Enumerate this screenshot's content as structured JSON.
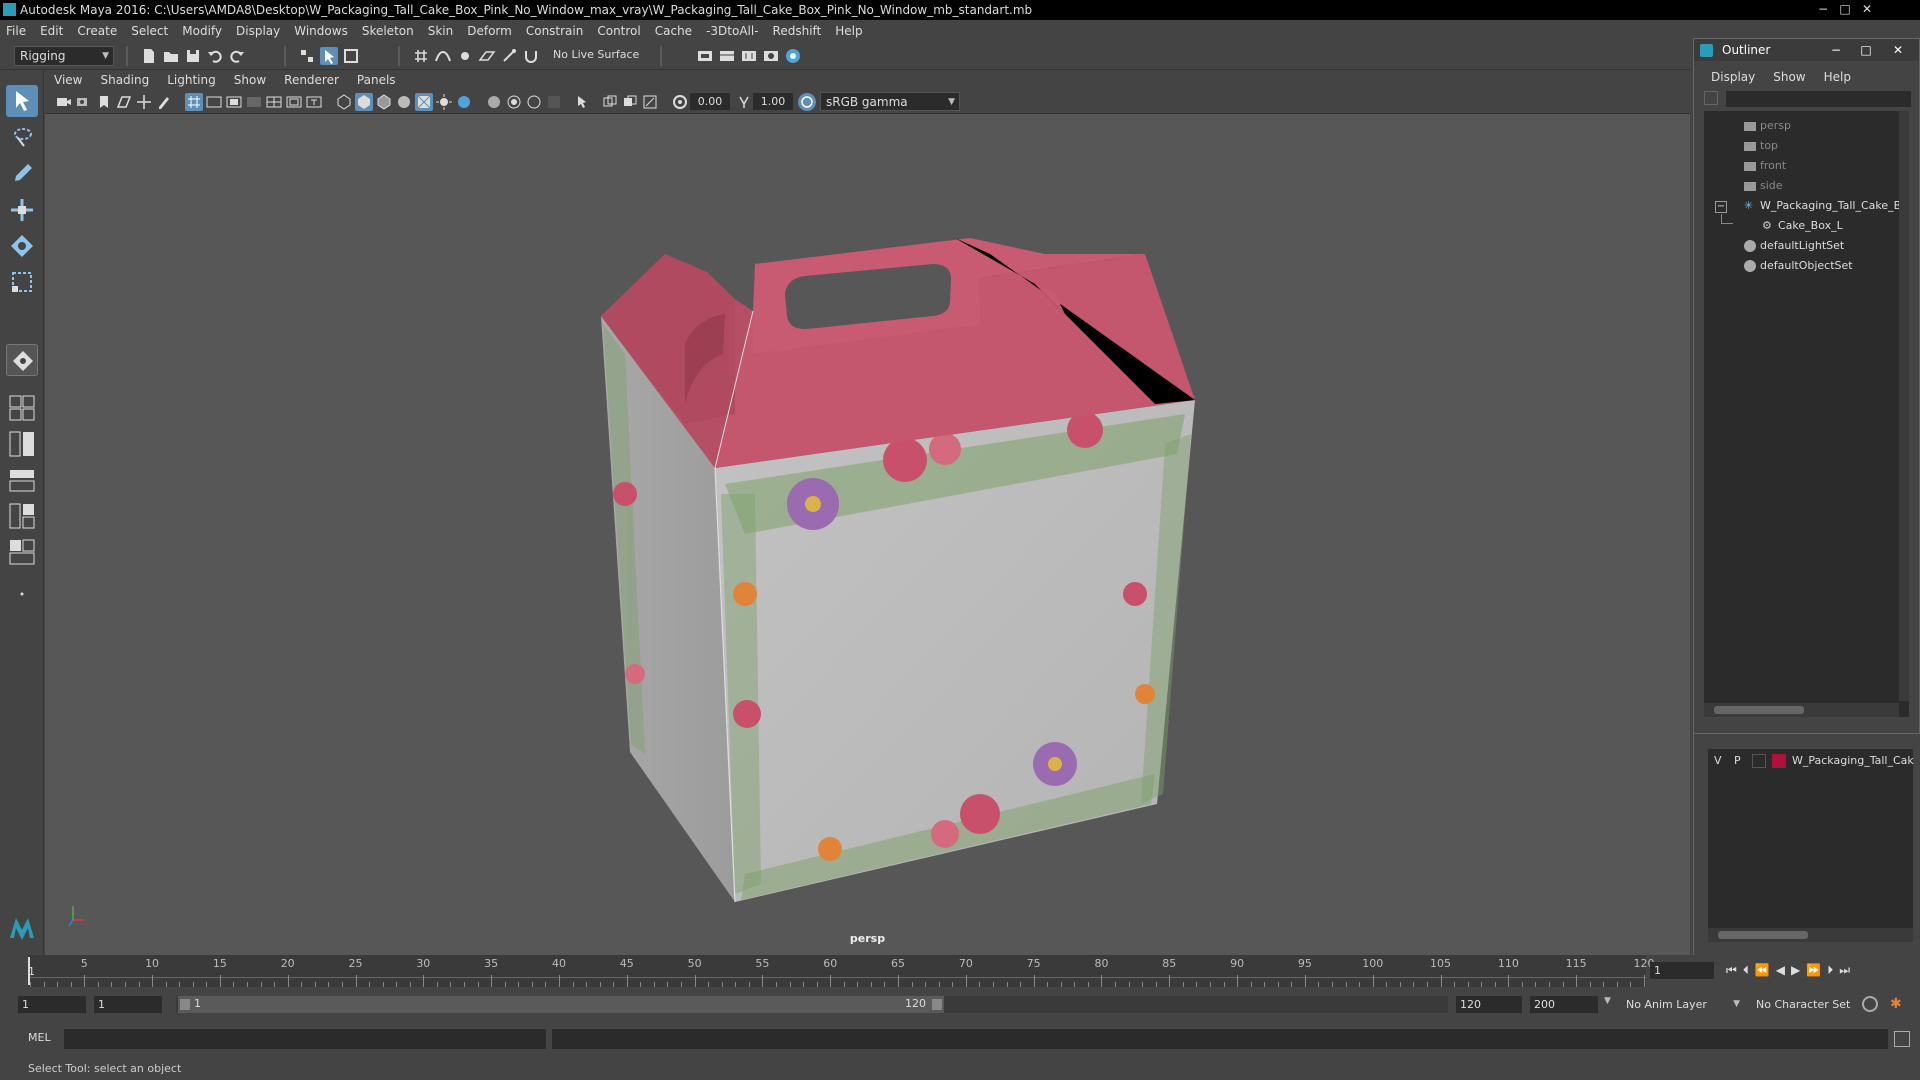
{
  "window": {
    "title": "Autodesk Maya 2016: C:\\Users\\AMDA8\\Desktop\\W_Packaging_Tall_Cake_Box_Pink_No_Window_max_vray\\W_Packaging_Tall_Cake_Box_Pink_No_Window_mb_standart.mb",
    "minimize": "−",
    "maximize": "□",
    "close": "✕"
  },
  "menubar": {
    "items": [
      "File",
      "Edit",
      "Create",
      "Select",
      "Modify",
      "Display",
      "Windows",
      "Skeleton",
      "Skin",
      "Deform",
      "Constrain",
      "Control",
      "Cache",
      "-3DtoAll-",
      "Redshift",
      "Help"
    ]
  },
  "statusline": {
    "mode": "Rigging",
    "live_surface": "No Live Surface"
  },
  "panel": {
    "menu": [
      "View",
      "Shading",
      "Lighting",
      "Show",
      "Renderer",
      "Panels"
    ],
    "exposure": "0.00",
    "gamma": "1.00",
    "color_space": "sRGB gamma",
    "camera_label": "persp"
  },
  "outliner": {
    "title": "Outliner",
    "menu": [
      "Display",
      "Show",
      "Help"
    ],
    "items": [
      {
        "label": "persp",
        "dim": true
      },
      {
        "label": "top",
        "dim": true
      },
      {
        "label": "front",
        "dim": true
      },
      {
        "label": "side",
        "dim": true
      },
      {
        "label": "W_Packaging_Tall_Cake_Bo",
        "dim": false
      },
      {
        "label": "Cake_Box_L",
        "dim": false
      },
      {
        "label": "defaultLightSet",
        "dim": false
      },
      {
        "label": "defaultObjectSet",
        "dim": false
      }
    ],
    "collapse_glyph": "−"
  },
  "layers": {
    "v": "V",
    "p": "P",
    "layer_name": "W_Packaging_Tall_Cak",
    "layer_color": "#b0103a"
  },
  "timeline": {
    "ticks": [
      "5",
      "10",
      "15",
      "20",
      "25",
      "30",
      "35",
      "40",
      "45",
      "50",
      "55",
      "60",
      "65",
      "70",
      "75",
      "80",
      "85",
      "90",
      "95",
      "100",
      "105",
      "110",
      "115",
      "120"
    ],
    "start_marker": "1",
    "current_frame": "1"
  },
  "range": {
    "start": "1",
    "playback_start": "1",
    "slider_start": "1",
    "slider_end": "120",
    "playback_end": "120",
    "end": "200",
    "anim_layer": "No Anim Layer",
    "character_set": "No Character Set"
  },
  "command": {
    "lang": "MEL"
  },
  "help": {
    "text": "Select Tool: select an object"
  },
  "colors": {
    "box_pink": "#c4566d",
    "box_side": "#b9b9b9",
    "accent_blue": "#5d8fb8"
  }
}
